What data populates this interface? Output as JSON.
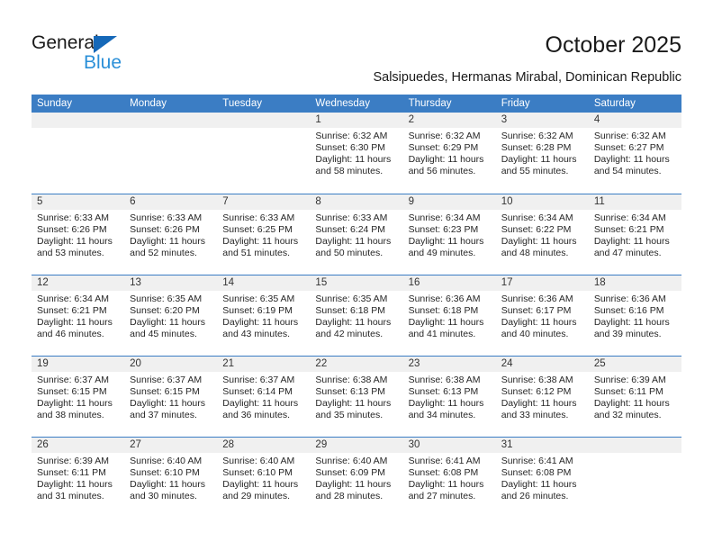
{
  "brand": {
    "name_top": "General",
    "name_bottom": "Blue",
    "accent_color": "#2a8fd8",
    "triangle_color": "#1568b8",
    "triangle_icon": "triangle-right-icon"
  },
  "header": {
    "title": "October 2025",
    "subtitle": "Salsipuedes, Hermanas Mirabal, Dominican Republic"
  },
  "theme": {
    "header_row_bg": "#3b7dc4",
    "header_row_text": "#ffffff",
    "day_number_bg": "#f0f0f0",
    "row_divider": "#3b7dc4",
    "body_text": "#262626"
  },
  "weekdays": [
    "Sunday",
    "Monday",
    "Tuesday",
    "Wednesday",
    "Thursday",
    "Friday",
    "Saturday"
  ],
  "weeks": [
    [
      {
        "day": "",
        "empty": true,
        "sunrise": "",
        "sunset": "",
        "daylight_line1": "",
        "daylight_line2": ""
      },
      {
        "day": "",
        "empty": true,
        "sunrise": "",
        "sunset": "",
        "daylight_line1": "",
        "daylight_line2": ""
      },
      {
        "day": "",
        "empty": true,
        "sunrise": "",
        "sunset": "",
        "daylight_line1": "",
        "daylight_line2": ""
      },
      {
        "day": "1",
        "empty": false,
        "sunrise": "Sunrise: 6:32 AM",
        "sunset": "Sunset: 6:30 PM",
        "daylight_line1": "Daylight: 11 hours",
        "daylight_line2": "and 58 minutes."
      },
      {
        "day": "2",
        "empty": false,
        "sunrise": "Sunrise: 6:32 AM",
        "sunset": "Sunset: 6:29 PM",
        "daylight_line1": "Daylight: 11 hours",
        "daylight_line2": "and 56 minutes."
      },
      {
        "day": "3",
        "empty": false,
        "sunrise": "Sunrise: 6:32 AM",
        "sunset": "Sunset: 6:28 PM",
        "daylight_line1": "Daylight: 11 hours",
        "daylight_line2": "and 55 minutes."
      },
      {
        "day": "4",
        "empty": false,
        "sunrise": "Sunrise: 6:32 AM",
        "sunset": "Sunset: 6:27 PM",
        "daylight_line1": "Daylight: 11 hours",
        "daylight_line2": "and 54 minutes."
      }
    ],
    [
      {
        "day": "5",
        "empty": false,
        "sunrise": "Sunrise: 6:33 AM",
        "sunset": "Sunset: 6:26 PM",
        "daylight_line1": "Daylight: 11 hours",
        "daylight_line2": "and 53 minutes."
      },
      {
        "day": "6",
        "empty": false,
        "sunrise": "Sunrise: 6:33 AM",
        "sunset": "Sunset: 6:26 PM",
        "daylight_line1": "Daylight: 11 hours",
        "daylight_line2": "and 52 minutes."
      },
      {
        "day": "7",
        "empty": false,
        "sunrise": "Sunrise: 6:33 AM",
        "sunset": "Sunset: 6:25 PM",
        "daylight_line1": "Daylight: 11 hours",
        "daylight_line2": "and 51 minutes."
      },
      {
        "day": "8",
        "empty": false,
        "sunrise": "Sunrise: 6:33 AM",
        "sunset": "Sunset: 6:24 PM",
        "daylight_line1": "Daylight: 11 hours",
        "daylight_line2": "and 50 minutes."
      },
      {
        "day": "9",
        "empty": false,
        "sunrise": "Sunrise: 6:34 AM",
        "sunset": "Sunset: 6:23 PM",
        "daylight_line1": "Daylight: 11 hours",
        "daylight_line2": "and 49 minutes."
      },
      {
        "day": "10",
        "empty": false,
        "sunrise": "Sunrise: 6:34 AM",
        "sunset": "Sunset: 6:22 PM",
        "daylight_line1": "Daylight: 11 hours",
        "daylight_line2": "and 48 minutes."
      },
      {
        "day": "11",
        "empty": false,
        "sunrise": "Sunrise: 6:34 AM",
        "sunset": "Sunset: 6:21 PM",
        "daylight_line1": "Daylight: 11 hours",
        "daylight_line2": "and 47 minutes."
      }
    ],
    [
      {
        "day": "12",
        "empty": false,
        "sunrise": "Sunrise: 6:34 AM",
        "sunset": "Sunset: 6:21 PM",
        "daylight_line1": "Daylight: 11 hours",
        "daylight_line2": "and 46 minutes."
      },
      {
        "day": "13",
        "empty": false,
        "sunrise": "Sunrise: 6:35 AM",
        "sunset": "Sunset: 6:20 PM",
        "daylight_line1": "Daylight: 11 hours",
        "daylight_line2": "and 45 minutes."
      },
      {
        "day": "14",
        "empty": false,
        "sunrise": "Sunrise: 6:35 AM",
        "sunset": "Sunset: 6:19 PM",
        "daylight_line1": "Daylight: 11 hours",
        "daylight_line2": "and 43 minutes."
      },
      {
        "day": "15",
        "empty": false,
        "sunrise": "Sunrise: 6:35 AM",
        "sunset": "Sunset: 6:18 PM",
        "daylight_line1": "Daylight: 11 hours",
        "daylight_line2": "and 42 minutes."
      },
      {
        "day": "16",
        "empty": false,
        "sunrise": "Sunrise: 6:36 AM",
        "sunset": "Sunset: 6:18 PM",
        "daylight_line1": "Daylight: 11 hours",
        "daylight_line2": "and 41 minutes."
      },
      {
        "day": "17",
        "empty": false,
        "sunrise": "Sunrise: 6:36 AM",
        "sunset": "Sunset: 6:17 PM",
        "daylight_line1": "Daylight: 11 hours",
        "daylight_line2": "and 40 minutes."
      },
      {
        "day": "18",
        "empty": false,
        "sunrise": "Sunrise: 6:36 AM",
        "sunset": "Sunset: 6:16 PM",
        "daylight_line1": "Daylight: 11 hours",
        "daylight_line2": "and 39 minutes."
      }
    ],
    [
      {
        "day": "19",
        "empty": false,
        "sunrise": "Sunrise: 6:37 AM",
        "sunset": "Sunset: 6:15 PM",
        "daylight_line1": "Daylight: 11 hours",
        "daylight_line2": "and 38 minutes."
      },
      {
        "day": "20",
        "empty": false,
        "sunrise": "Sunrise: 6:37 AM",
        "sunset": "Sunset: 6:15 PM",
        "daylight_line1": "Daylight: 11 hours",
        "daylight_line2": "and 37 minutes."
      },
      {
        "day": "21",
        "empty": false,
        "sunrise": "Sunrise: 6:37 AM",
        "sunset": "Sunset: 6:14 PM",
        "daylight_line1": "Daylight: 11 hours",
        "daylight_line2": "and 36 minutes."
      },
      {
        "day": "22",
        "empty": false,
        "sunrise": "Sunrise: 6:38 AM",
        "sunset": "Sunset: 6:13 PM",
        "daylight_line1": "Daylight: 11 hours",
        "daylight_line2": "and 35 minutes."
      },
      {
        "day": "23",
        "empty": false,
        "sunrise": "Sunrise: 6:38 AM",
        "sunset": "Sunset: 6:13 PM",
        "daylight_line1": "Daylight: 11 hours",
        "daylight_line2": "and 34 minutes."
      },
      {
        "day": "24",
        "empty": false,
        "sunrise": "Sunrise: 6:38 AM",
        "sunset": "Sunset: 6:12 PM",
        "daylight_line1": "Daylight: 11 hours",
        "daylight_line2": "and 33 minutes."
      },
      {
        "day": "25",
        "empty": false,
        "sunrise": "Sunrise: 6:39 AM",
        "sunset": "Sunset: 6:11 PM",
        "daylight_line1": "Daylight: 11 hours",
        "daylight_line2": "and 32 minutes."
      }
    ],
    [
      {
        "day": "26",
        "empty": false,
        "sunrise": "Sunrise: 6:39 AM",
        "sunset": "Sunset: 6:11 PM",
        "daylight_line1": "Daylight: 11 hours",
        "daylight_line2": "and 31 minutes."
      },
      {
        "day": "27",
        "empty": false,
        "sunrise": "Sunrise: 6:40 AM",
        "sunset": "Sunset: 6:10 PM",
        "daylight_line1": "Daylight: 11 hours",
        "daylight_line2": "and 30 minutes."
      },
      {
        "day": "28",
        "empty": false,
        "sunrise": "Sunrise: 6:40 AM",
        "sunset": "Sunset: 6:10 PM",
        "daylight_line1": "Daylight: 11 hours",
        "daylight_line2": "and 29 minutes."
      },
      {
        "day": "29",
        "empty": false,
        "sunrise": "Sunrise: 6:40 AM",
        "sunset": "Sunset: 6:09 PM",
        "daylight_line1": "Daylight: 11 hours",
        "daylight_line2": "and 28 minutes."
      },
      {
        "day": "30",
        "empty": false,
        "sunrise": "Sunrise: 6:41 AM",
        "sunset": "Sunset: 6:08 PM",
        "daylight_line1": "Daylight: 11 hours",
        "daylight_line2": "and 27 minutes."
      },
      {
        "day": "31",
        "empty": false,
        "sunrise": "Sunrise: 6:41 AM",
        "sunset": "Sunset: 6:08 PM",
        "daylight_line1": "Daylight: 11 hours",
        "daylight_line2": "and 26 minutes."
      },
      {
        "day": "",
        "empty": true,
        "sunrise": "",
        "sunset": "",
        "daylight_line1": "",
        "daylight_line2": ""
      }
    ]
  ]
}
